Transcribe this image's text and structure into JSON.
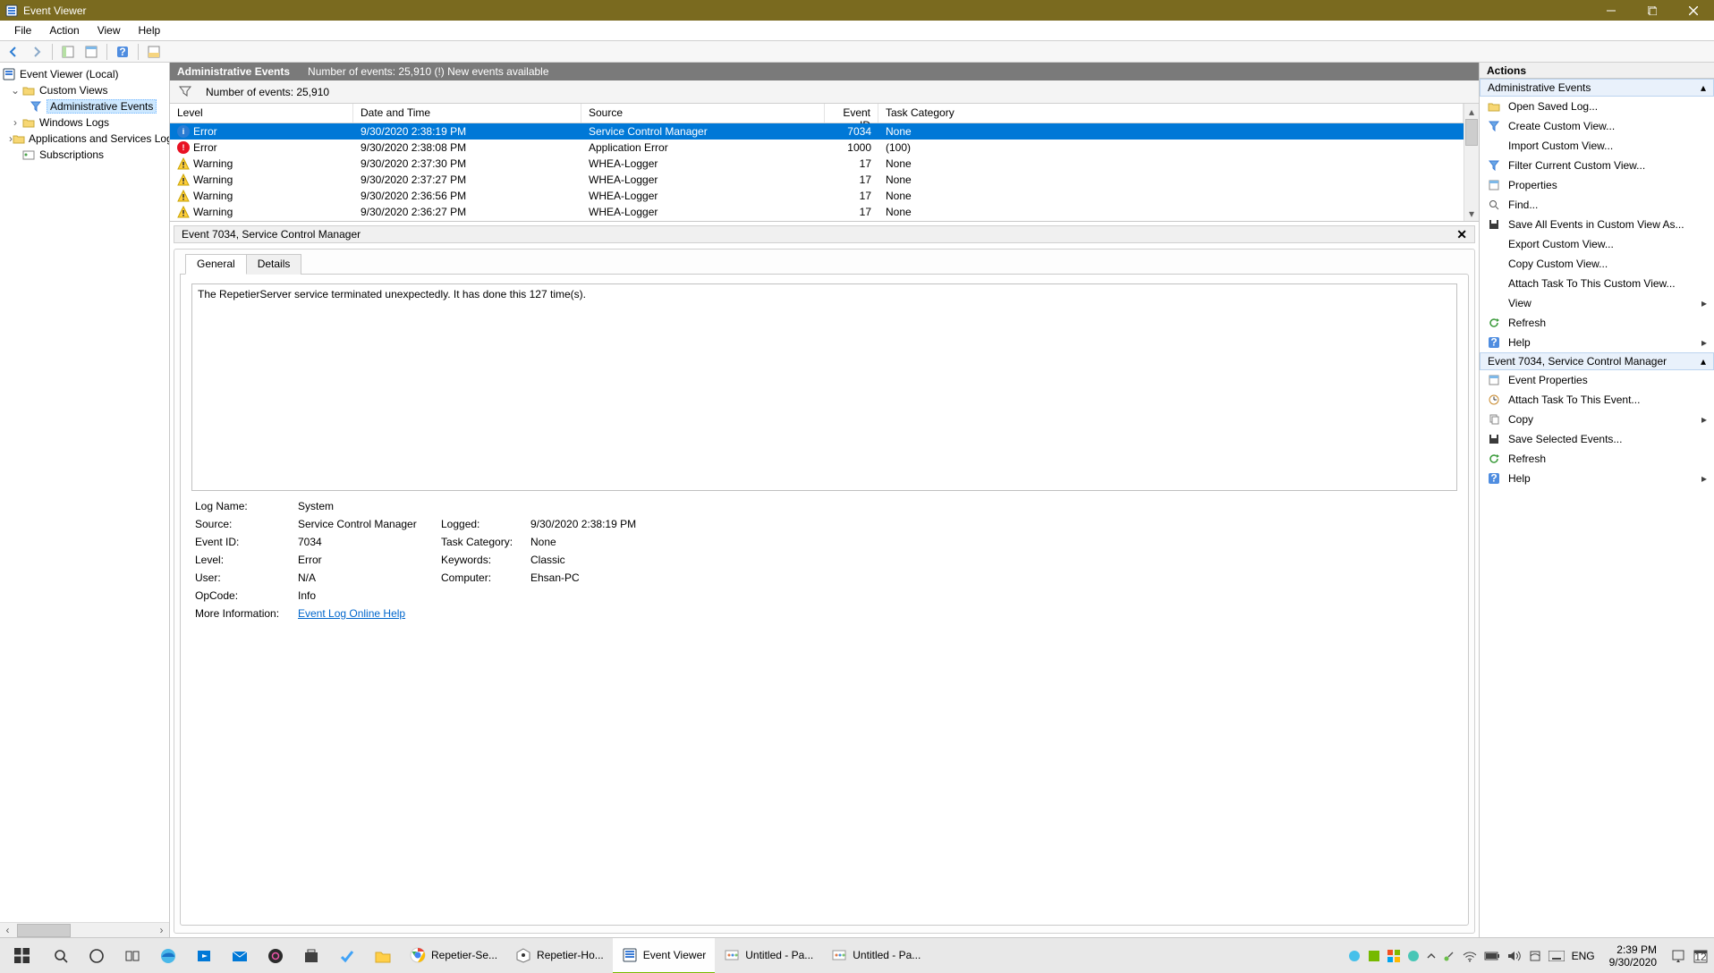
{
  "titlebar": {
    "title": "Event Viewer"
  },
  "menu": {
    "file": "File",
    "action": "Action",
    "view": "View",
    "help": "Help"
  },
  "nav": {
    "root": "Event Viewer (Local)",
    "custom_views": "Custom Views",
    "admin_events": "Administrative Events",
    "windows_logs": "Windows Logs",
    "apps_services": "Applications and Services Logs",
    "subscriptions": "Subscriptions"
  },
  "content_header": {
    "title": "Administrative Events",
    "subtitle": "Number of events: 25,910 (!) New events available"
  },
  "filterbar": {
    "count": "Number of events: 25,910"
  },
  "grid": {
    "cols": {
      "level": "Level",
      "date": "Date and Time",
      "source": "Source",
      "id": "Event ID",
      "cat": "Task Category"
    },
    "rows": [
      {
        "lvl": "Error",
        "icon": "info",
        "date": "9/30/2020 2:38:19 PM",
        "src": "Service Control Manager",
        "id": "7034",
        "cat": "None",
        "sel": true
      },
      {
        "lvl": "Error",
        "icon": "err",
        "date": "9/30/2020 2:38:08 PM",
        "src": "Application Error",
        "id": "1000",
        "cat": "(100)"
      },
      {
        "lvl": "Warning",
        "icon": "warn",
        "date": "9/30/2020 2:37:30 PM",
        "src": "WHEA-Logger",
        "id": "17",
        "cat": "None"
      },
      {
        "lvl": "Warning",
        "icon": "warn",
        "date": "9/30/2020 2:37:27 PM",
        "src": "WHEA-Logger",
        "id": "17",
        "cat": "None"
      },
      {
        "lvl": "Warning",
        "icon": "warn",
        "date": "9/30/2020 2:36:56 PM",
        "src": "WHEA-Logger",
        "id": "17",
        "cat": "None"
      },
      {
        "lvl": "Warning",
        "icon": "warn",
        "date": "9/30/2020 2:36:27 PM",
        "src": "WHEA-Logger",
        "id": "17",
        "cat": "None"
      }
    ]
  },
  "detail": {
    "header": "Event 7034, Service Control Manager",
    "tabs": {
      "general": "General",
      "details": "Details"
    },
    "message": "The RepetierServer service terminated unexpectedly.  It has done this 127 time(s).",
    "props": {
      "log_name_k": "Log Name:",
      "log_name_v": "System",
      "source_k": "Source:",
      "source_v": "Service Control Manager",
      "logged_k": "Logged:",
      "logged_v": "9/30/2020 2:38:19 PM",
      "event_id_k": "Event ID:",
      "event_id_v": "7034",
      "task_cat_k": "Task Category:",
      "task_cat_v": "None",
      "level_k": "Level:",
      "level_v": "Error",
      "keywords_k": "Keywords:",
      "keywords_v": "Classic",
      "user_k": "User:",
      "user_v": "N/A",
      "computer_k": "Computer:",
      "computer_v": "Ehsan-PC",
      "opcode_k": "OpCode:",
      "opcode_v": "Info",
      "more_k": "More Information:",
      "more_link": "Event Log Online Help"
    }
  },
  "actions": {
    "title": "Actions",
    "section1": "Administrative Events",
    "items1": [
      "Open Saved Log...",
      "Create Custom View...",
      "Import Custom View...",
      "Filter Current Custom View...",
      "Properties",
      "Find...",
      "Save All Events in Custom View As...",
      "Export Custom View...",
      "Copy Custom View...",
      "Attach Task To This Custom View...",
      "View",
      "Refresh",
      "Help"
    ],
    "section2": "Event 7034, Service Control Manager",
    "items2": [
      "Event Properties",
      "Attach Task To This Event...",
      "Copy",
      "Save Selected Events...",
      "Refresh",
      "Help"
    ]
  },
  "taskbar": {
    "apps": [
      {
        "label": "Repetier-Se..."
      },
      {
        "label": "Repetier-Ho..."
      },
      {
        "label": "Event Viewer",
        "active": true
      },
      {
        "label": "Untitled - Pa..."
      },
      {
        "label": "Untitled - Pa..."
      }
    ],
    "lang": "ENG",
    "time": "2:39 PM",
    "date": "9/30/2020"
  }
}
